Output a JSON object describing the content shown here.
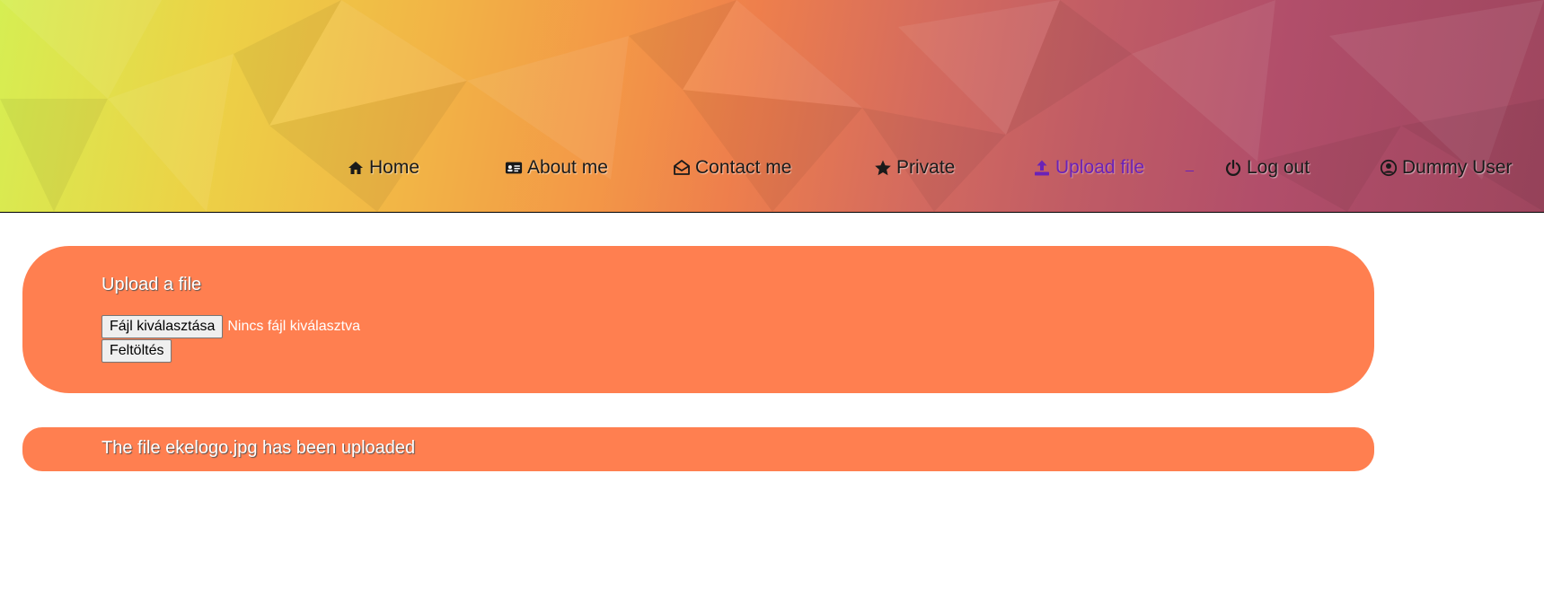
{
  "nav": {
    "items": [
      {
        "label": "Home",
        "icon": "home-icon"
      },
      {
        "label": "About me",
        "icon": "id-card-icon"
      },
      {
        "label": "Contact me",
        "icon": "envelope-open-icon"
      },
      {
        "label": "Private",
        "icon": "star-icon"
      },
      {
        "label": "Upload file",
        "icon": "upload-icon",
        "active": true
      },
      {
        "label": "Log out",
        "icon": "power-icon"
      },
      {
        "label": "Dummy User",
        "icon": "user-circle-icon"
      }
    ],
    "underscore_link": "_"
  },
  "upload": {
    "title": "Upload a file",
    "choose_button": "Fájl kiválasztása",
    "no_file_text": "Nincs fájl kiválasztva",
    "submit_button": "Feltöltés"
  },
  "message": {
    "text": "The file ekelogo.jpg has been uploaded"
  },
  "colors": {
    "card": "#ff7f50",
    "active_nav": "#6a22b8"
  }
}
